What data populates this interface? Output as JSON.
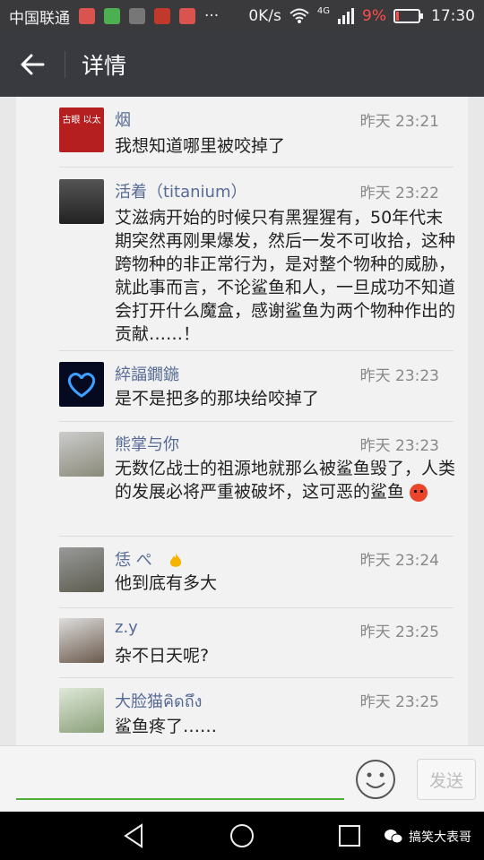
{
  "status_bar": {
    "carrier": "中国联通",
    "more": "···",
    "speed": "0K/s",
    "network": "4G",
    "battery": "9%",
    "time": "17:30"
  },
  "header": {
    "title": "详情"
  },
  "messages": [
    {
      "name": "烟",
      "time": "昨天 23:21",
      "text": "我想知道哪里被咬掉了",
      "avatar_label": "古眼 以太"
    },
    {
      "name": "活着（titanium）",
      "time": "昨天 23:22",
      "text": "艾滋病开始的时候只有黑猩猩有，50年代末期突然再刚果爆发，然后一发不可收拾，这种跨物种的非正常行为，是对整个物种的威胁，就此事而言，不论鲨鱼和人，一旦成功不知道会打开什么魔盒，感谢鲨鱼为两个物种作出的贡献……！"
    },
    {
      "name": "綷諨鐗鍦",
      "time": "昨天 23:23",
      "text": "是不是把多的那块给咬掉了"
    },
    {
      "name": "熊掌与你",
      "time": "昨天 23:23",
      "text": "无数亿战士的祖源地就那么被鲨鱼毁了，人类的发展必将严重被破坏，这可恶的鲨鱼"
    },
    {
      "name": "恁  ぺ",
      "time": "昨天 23:24",
      "text": "他到底有多大"
    },
    {
      "name": "z.y",
      "time": "昨天 23:25",
      "text": "杂不日天呢?"
    },
    {
      "name": "大脸猫คิดถึง",
      "time": "昨天 23:25",
      "text": "鲨鱼疼了……"
    }
  ],
  "input_bar": {
    "send_label": "发送"
  },
  "watermark": {
    "text": "搞笑大表哥"
  },
  "colors": {
    "title_bar": "#393a3f",
    "name": "#576b95",
    "input_underline": "#4fae3a"
  }
}
